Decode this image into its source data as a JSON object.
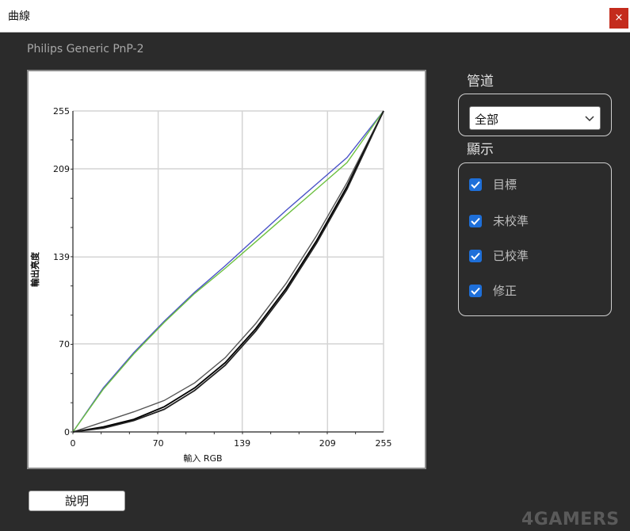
{
  "window": {
    "title": "曲線",
    "close_glyph": "×"
  },
  "device_name": "Philips Generic PnP-2",
  "channel": {
    "heading": "管道",
    "selected": "全部"
  },
  "display": {
    "heading": "顯示",
    "items": [
      {
        "label": "目標",
        "checked": true
      },
      {
        "label": "未校準",
        "checked": true
      },
      {
        "label": "已校準",
        "checked": true
      },
      {
        "label": "修正",
        "checked": true
      }
    ]
  },
  "help_button": "說明",
  "watermark": "4GAMERS",
  "chart_data": {
    "type": "line",
    "xlabel": "輸入 RGB",
    "ylabel": "輸出亮度",
    "xlim": [
      0,
      255
    ],
    "ylim": [
      0,
      255
    ],
    "xticks": [
      "0",
      "70",
      "139",
      "209",
      "255"
    ],
    "yticks": [
      "0",
      "70",
      "139",
      "209",
      "255"
    ],
    "grid": true,
    "series": [
      {
        "color": "#4a52c8",
        "x": [
          0,
          25,
          50,
          75,
          100,
          125,
          150,
          175,
          200,
          225,
          255
        ],
        "y": [
          0,
          35,
          63,
          88,
          111,
          132,
          154,
          176,
          197,
          218,
          255
        ]
      },
      {
        "color": "#6cc040",
        "x": [
          0,
          25,
          50,
          75,
          100,
          125,
          150,
          175,
          200,
          225,
          255
        ],
        "y": [
          0,
          34,
          62,
          87,
          110,
          130,
          151,
          172,
          193,
          214,
          255
        ]
      },
      {
        "color": "#555555",
        "x": [
          0,
          25,
          50,
          75,
          100,
          125,
          150,
          175,
          200,
          225,
          255
        ],
        "y": [
          0,
          8,
          16,
          25,
          39,
          59,
          86,
          118,
          156,
          198,
          255
        ]
      },
      {
        "color": "#000000",
        "x": [
          0,
          25,
          50,
          75,
          100,
          125,
          150,
          175,
          200,
          225,
          255
        ],
        "y": [
          0,
          4,
          10,
          20,
          35,
          55,
          82,
          114,
          152,
          195,
          255
        ]
      },
      {
        "color": "#222222",
        "x": [
          0,
          25,
          50,
          75,
          100,
          125,
          150,
          175,
          200,
          225,
          255
        ],
        "y": [
          0,
          3,
          9,
          18,
          33,
          53,
          80,
          112,
          150,
          193,
          255
        ]
      }
    ]
  }
}
